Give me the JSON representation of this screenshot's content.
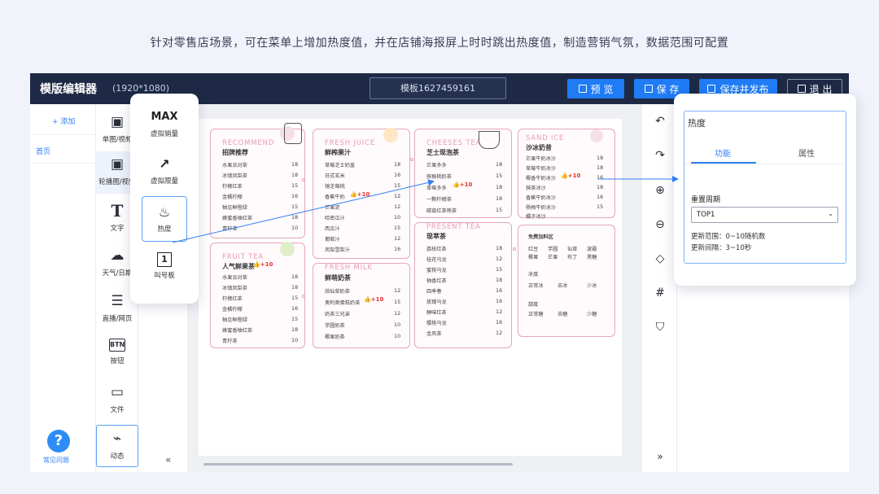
{
  "caption": "针对零售店场景，可在菜单上增加热度值，并在店铺海报屏上时时跳出热度值，制造营销气氛，数据范围可配置",
  "topbar": {
    "title": "模版编辑器",
    "resolution": "(1920*1080)",
    "template_name": "模板1627459161",
    "preview_label": "预 览",
    "save_label": "保 存",
    "save_publish_label": "保存并发布",
    "exit_label": "退 出"
  },
  "nav": {
    "add_label": "+ 添加",
    "page_label": "首页",
    "help_label": "常见问题"
  },
  "tools": [
    {
      "label": "单图/视频",
      "icon": "image-icon"
    },
    {
      "label": "轮播图/视频",
      "icon": "carousel-icon"
    },
    {
      "label": "文字",
      "icon": "text-icon"
    },
    {
      "label": "天气/日期",
      "icon": "cloud-icon"
    },
    {
      "label": "直播/网页",
      "icon": "browser-icon"
    },
    {
      "label": "按钮",
      "icon": "button-icon"
    },
    {
      "label": "文件",
      "icon": "folder-icon"
    },
    {
      "label": "动态",
      "icon": "chart-icon"
    }
  ],
  "float_tools": [
    {
      "label": "虚拟销量",
      "glyph": "MAX"
    },
    {
      "label": "虚拟限量",
      "glyph": "↗"
    },
    {
      "label": "热度",
      "glyph": "♨"
    },
    {
      "label": "叫号板",
      "glyph": "1"
    }
  ],
  "panel": {
    "title": "热度",
    "tab_function": "功能",
    "tab_property": "属性",
    "reset_label": "重置周期",
    "select_value": "TOP1",
    "range_text": "更新范围：0~10随机数",
    "interval_text": "更新间隔：3~10秒"
  },
  "menu": {
    "hot_label": "+10",
    "recommend": {
      "en": "RECOMMEND",
      "zh": "招牌推荐",
      "items": [
        "水果派对茶",
        "冰镇凤梨茶",
        "柠檬红茶",
        "金橘柠檬",
        "柚见鲜橙绿",
        "蜂蜜香柚红茶",
        "青柠茶"
      ],
      "prices": [
        "18",
        "18",
        "15",
        "16",
        "15",
        "18",
        "10"
      ]
    },
    "juice": {
      "en": "FRESH JUICE",
      "zh": "鲜榨果汁",
      "items": [
        "草莓芝士奶盖",
        "日式玄米",
        "镜芝莓桃",
        "香蕉牛奶",
        "芒果泥",
        "哈密瓜汁",
        "西瓜汁",
        "葡萄汁",
        "凤梨雪梨汁"
      ],
      "prices": [
        "18",
        "16",
        "15",
        "12",
        "12",
        "10",
        "15",
        "12",
        "16"
      ]
    },
    "cheese": {
      "en": "CHEESES TEA",
      "zh": "芝士现泡茶",
      "items": [
        "芒果多多",
        "猕猴桃奶茶",
        "草莓多多",
        "一颗柠檬茶",
        "碳菊红茶熊茶"
      ],
      "prices": [
        "18",
        "15",
        "18",
        "18",
        "15"
      ]
    },
    "ice": {
      "en": "SAND ICE",
      "zh": "沙冰奶昔",
      "items": [
        "芒果牛奶冰沙",
        "草莓牛奶冰沙",
        "椰香牛奶冰沙",
        "抹茶冰沙",
        "香蕉牛奶冰沙",
        "杨梅牛奶冰沙",
        "橘子冰沙"
      ],
      "prices": [
        "18",
        "18",
        "16",
        "18",
        "16",
        "15",
        "15"
      ]
    },
    "fruit": {
      "en": "FRUIT TEA",
      "zh": "人气鲜果茶",
      "items": [
        "水果派对茶",
        "冰镇凤梨茶",
        "柠檬红茶",
        "金橘柠檬",
        "柚见鲜橙绿",
        "蜂蜜香柚红茶",
        "青柠茶"
      ],
      "prices": [
        "18",
        "18",
        "15",
        "16",
        "15",
        "18",
        "10"
      ]
    },
    "milk": {
      "en": "FRESH MILK",
      "zh": "鲜萌奶茶",
      "items": [
        "焙仙草奶茶",
        "奥利奥蛋糕奶茶",
        "奶茶三兄弟",
        "芋圆奶茶",
        "椰果奶茶"
      ],
      "prices": [
        "12",
        "15",
        "12",
        "10",
        "10"
      ]
    },
    "present": {
      "en": "PRESENT TEA",
      "zh": "现萃茶",
      "items": [
        "荔枝红茶",
        "桂花乌龙",
        "蜜桃乌龙",
        "柚香红茶",
        "四季春",
        "玫瑰乌龙",
        "醇味红茶",
        "樱桃乌龙",
        "金凤茶"
      ],
      "prices": [
        "18",
        "12",
        "15",
        "18",
        "16",
        "16",
        "12",
        "16",
        "12"
      ]
    },
    "addon": {
      "title": "免费加料区",
      "toppings": [
        "红豆",
        "芋圆",
        "仙草",
        "波霸",
        "椰果",
        "芒果",
        "布丁",
        "黑糖"
      ],
      "ice_title": "冰度",
      "ice_options": [
        "正常冰",
        "去冰",
        "少冰"
      ],
      "sugar_title": "甜度",
      "sugar_options": [
        "正常糖",
        "去糖",
        "少糖"
      ]
    }
  }
}
